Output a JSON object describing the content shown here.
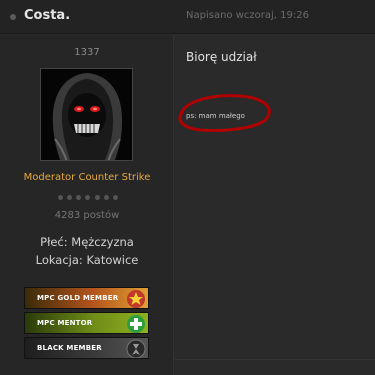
{
  "header": {
    "author_name": "Costa.",
    "post_date": "Napisano wczoraj, 19:26"
  },
  "author": {
    "user_id": "1337",
    "group_title": "Moderator Counter Strike",
    "posts_count": "4283 postów",
    "gender_label": "Płeć: Mężczyzna",
    "location_label": "Lokacja: Katowice",
    "rank_pips": 7
  },
  "badges": [
    {
      "label": "MPC GOLD MEMBER",
      "icon": "star-icon",
      "color": "#e0a032"
    },
    {
      "label": "MPC MENTOR",
      "icon": "plus-icon",
      "color": "#8fb020"
    },
    {
      "label": "BLACK MEMBER",
      "icon": "ribbon-icon",
      "color": "#555555"
    }
  ],
  "post": {
    "text": "Biorę udział",
    "ps_text": "ps: mam małego",
    "annotation_color": "#b00000"
  }
}
